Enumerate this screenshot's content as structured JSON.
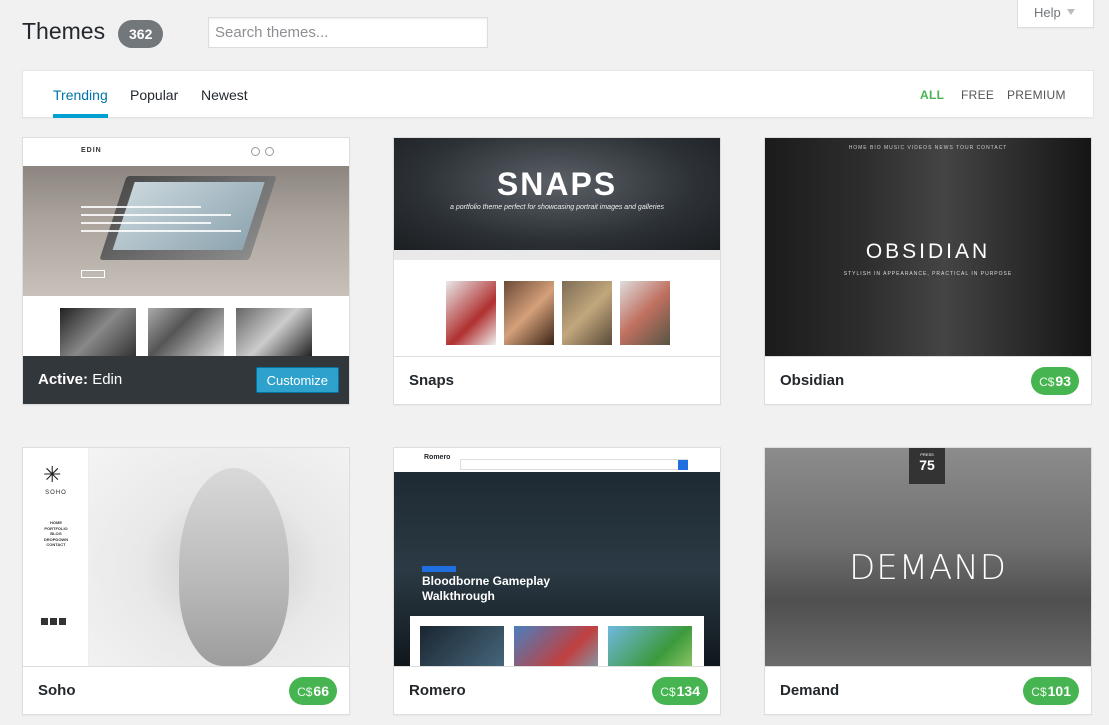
{
  "header": {
    "title": "Themes",
    "count": "362",
    "search_placeholder": "Search themes...",
    "help_label": "Help"
  },
  "filters": {
    "tabs": [
      "Trending",
      "Popular",
      "Newest"
    ],
    "types": [
      "ALL",
      "FREE",
      "PREMIUM"
    ]
  },
  "themes": [
    {
      "name": "Edin",
      "active_prefix": "Active:",
      "button": "Customize"
    },
    {
      "name": "Snaps"
    },
    {
      "name": "Obsidian",
      "currency": "C$",
      "price": "93"
    },
    {
      "name": "Soho",
      "currency": "C$",
      "price": "66"
    },
    {
      "name": "Romero",
      "currency": "C$",
      "price": "134"
    },
    {
      "name": "Demand",
      "currency": "C$",
      "price": "101"
    }
  ],
  "previews": {
    "edin_logo": "EDIN",
    "snaps_title": "SNAPS",
    "snaps_sub": "a portfolio theme perfect for showcasing portrait images and galleries",
    "obsidian_nav": "HOME  BIO  MUSIC  VIDEOS  NEWS  TOUR  CONTACT",
    "obsidian_title": "OBSIDIAN",
    "obsidian_sub": "STYLISH IN APPEARANCE, PRACTICAL IN PURPOSE",
    "soho_logo": "SOHO",
    "soho_menu": [
      "HOME",
      "PORTFOLIO",
      "BLOG",
      "DROPDOWN",
      "CONTACT"
    ],
    "romero_logo": "Romero",
    "romero_headline": "Bloodborne Gameplay Walkthrough",
    "demand_badge_top": "PRESS",
    "demand_badge_num": "75",
    "demand_title": "DEMAND"
  },
  "colors": {
    "accent": "#0073aa",
    "price_green": "#46b450",
    "customize_blue": "#2ea2cc"
  }
}
